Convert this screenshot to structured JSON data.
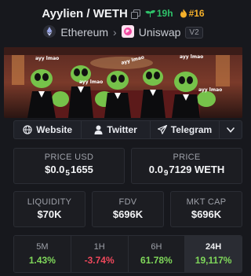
{
  "header": {
    "title": "Ayylien / WETH",
    "trend_value": "19h",
    "rank": "#16",
    "chain": "Ethereum",
    "dex": "Uniswap",
    "dex_version": "V2"
  },
  "social": {
    "website": "Website",
    "twitter": "Twitter",
    "telegram": "Telegram"
  },
  "stats": {
    "price_usd_label": "PRICE USD",
    "price_usd_prefix": "$0.0",
    "price_usd_zeros": "5",
    "price_usd_digits": "1655",
    "price_label": "PRICE",
    "price_prefix": "0.0",
    "price_zeros": "9",
    "price_digits": "7129 WETH",
    "liquidity_label": "LIQUIDITY",
    "liquidity_value": "$70K",
    "fdv_label": "FDV",
    "fdv_value": "$696K",
    "mktcap_label": "MKT CAP",
    "mktcap_value": "$696K"
  },
  "timeframes": [
    {
      "label": "5M",
      "value": "1.43%"
    },
    {
      "label": "1H",
      "value": "-3.74%"
    },
    {
      "label": "6H",
      "value": "61.78%"
    },
    {
      "label": "24H",
      "value": "19,117%"
    }
  ],
  "colors": {
    "positive": "#7fd75a",
    "negative": "#f0485b",
    "trend_green": "#2fc26a",
    "rank_orange": "#f5b02a",
    "background": "#17181d"
  }
}
